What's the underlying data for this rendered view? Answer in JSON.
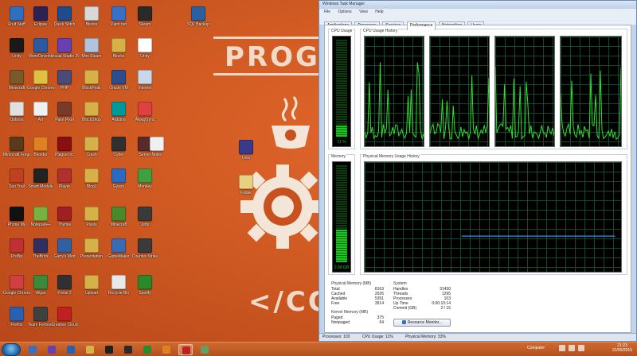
{
  "desktop": {
    "wallpaper_text": {
      "heading": "PROGRA",
      "code": "</CO"
    },
    "icons": [
      {
        "label": "Fruit Stuff",
        "color": "#2e6fbf"
      },
      {
        "label": "Eclipse",
        "color": "#2c2255"
      },
      {
        "label": "Quick Stitch",
        "color": "#1e4b8c"
      },
      {
        "label": "Blocks",
        "color": "#d8d8d8"
      },
      {
        "label": "Paint.net",
        "color": "#3a6fc8"
      },
      {
        "label": "Steam",
        "color": "#2a2a2a"
      },
      {
        "label": "Unity",
        "color": "#1a1a1a"
      },
      {
        "label": "MonoDevelop",
        "color": "#2c5aa0"
      },
      {
        "label": "Visual Studio 2013",
        "color": "#6a3fb0"
      },
      {
        "label": "Mini Steam",
        "color": "#b0c4de"
      },
      {
        "label": "Blocks",
        "color": "#d8b048"
      },
      {
        "label": "Unity",
        "color": "#ffffff"
      },
      {
        "label": "Minecraft",
        "color": "#7a5a2a"
      },
      {
        "label": "Google Chrome",
        "color": "#e0c040"
      },
      {
        "label": "PHP",
        "color": "#4b4b7a"
      },
      {
        "label": "BlockPeak",
        "color": "#d8b048"
      },
      {
        "label": "Oracle VM",
        "color": "#2c4c8c"
      },
      {
        "label": "Internet",
        "color": "#c8d8e8"
      },
      {
        "label": "Options",
        "color": "#e0e0e0"
      },
      {
        "label": "Art",
        "color": "#f0f0f0"
      },
      {
        "label": "Paint Pixel",
        "color": "#7a3a2a"
      },
      {
        "label": "BlockShop",
        "color": "#d8b048"
      },
      {
        "label": "Arduino",
        "color": "#009999"
      },
      {
        "label": "AlwaySync",
        "color": "#e04040"
      },
      {
        "label": "Minecraft Forge",
        "color": "#5a3a1a"
      },
      {
        "label": "Blender",
        "color": "#e08020"
      },
      {
        "label": "Plague Inc",
        "color": "#8a1010"
      },
      {
        "label": "Crash",
        "color": "#d8b048"
      },
      {
        "label": "Cyber",
        "color": "#303030"
      },
      {
        "label": "Server",
        "color": "#5a2a2a"
      },
      {
        "label": "Sun Trail",
        "color": "#c04020"
      },
      {
        "label": "Smart Module",
        "color": "#222222"
      },
      {
        "label": "Player",
        "color": "#b03030"
      },
      {
        "label": "BlogJ",
        "color": "#d8b048"
      },
      {
        "label": "Gyazo",
        "color": "#2a6ac0"
      },
      {
        "label": "Monkey",
        "color": "#40a040"
      },
      {
        "label": "Phone My",
        "color": "#111111"
      },
      {
        "label": "Notepad++",
        "color": "#7ab040"
      },
      {
        "label": "Thymie",
        "color": "#a02020"
      },
      {
        "label": "Pixels",
        "color": "#d8b048"
      },
      {
        "label": "Minecraft",
        "color": "#4a8a2a"
      },
      {
        "label": "Jetty",
        "color": "#3a3a3a"
      },
      {
        "label": "ProBg",
        "color": "#c03030"
      },
      {
        "label": "TheBrick",
        "color": "#303060"
      },
      {
        "label": "Garry's Mod",
        "color": "#3060a0"
      },
      {
        "label": "Presentation",
        "color": "#d8b048"
      },
      {
        "label": "GameMaker",
        "color": "#3a6ab0"
      },
      {
        "label": "Counter-Strike",
        "color": "#3a3a3a"
      },
      {
        "label": "Google Chrome",
        "color": "#d04040"
      },
      {
        "label": "Wigar",
        "color": "#3a8a3a"
      },
      {
        "label": "Portal 2",
        "color": "#303030"
      },
      {
        "label": "Upload",
        "color": "#d8b048"
      },
      {
        "label": "Recycle Bin",
        "color": "#e8e8e8"
      },
      {
        "label": "Spotify",
        "color": "#2a8a2a"
      },
      {
        "label": "Firefox",
        "color": "#2a60b0"
      },
      {
        "label": "Team Fortress",
        "color": "#404040"
      },
      {
        "label": "Creative Cloud",
        "color": "#c02020"
      },
      {
        "label": "SQL Backup",
        "color": "#2a60a0"
      },
      {
        "label": "Unix",
        "color": "#3a3a8a"
      },
      {
        "label": "Folder",
        "color": "#e8d080"
      },
      {
        "label": "Notes",
        "color": "#f0f0f0"
      }
    ]
  },
  "taskmgr": {
    "title": "Windows Task Manager",
    "menu": [
      "File",
      "Options",
      "View",
      "Help"
    ],
    "tabs": [
      "Applications",
      "Processes",
      "Services",
      "Performance",
      "Networking",
      "Users"
    ],
    "active_tab": "Performance",
    "cpu_usage": {
      "label": "CPU Usage",
      "value_text": "11 %",
      "percent": 11
    },
    "cpu_history": {
      "label": "CPU Usage History",
      "cores": 4
    },
    "memory": {
      "label": "Memory",
      "value_text": "2.68 GB",
      "percent": 33
    },
    "memory_history": {
      "label": "Physical Memory Usage History",
      "level": 33
    },
    "physical_memory": {
      "title": "Physical Memory (MB)",
      "rows": [
        {
          "k": "Total",
          "v": "8163"
        },
        {
          "k": "Cached",
          "v": "2026"
        },
        {
          "k": "Available",
          "v": "5391"
        },
        {
          "k": "Free",
          "v": "3514"
        }
      ]
    },
    "kernel_memory": {
      "title": "Kernel Memory (MB)",
      "rows": [
        {
          "k": "Paged",
          "v": "375"
        },
        {
          "k": "Nonpaged",
          "v": "64"
        }
      ]
    },
    "system": {
      "title": "System",
      "rows": [
        {
          "k": "Handles",
          "v": "31430"
        },
        {
          "k": "Threads",
          "v": "1295"
        },
        {
          "k": "Processes",
          "v": "103"
        },
        {
          "k": "Up Time",
          "v": "0:00:10:14"
        },
        {
          "k": "Commit (GB)",
          "v": "2 / 15"
        }
      ]
    },
    "resource_monitor_button": "Resource Monitor...",
    "status": {
      "processes": "Processes: 103",
      "cpu": "CPU Usage: 11%",
      "memory": "Physical Memory: 33%"
    }
  },
  "taskbar": {
    "tray_label": "Computer",
    "time": "21:23",
    "date": "31/05/2015",
    "pinned_colors": [
      "#3b6fc2",
      "#6a3fb0",
      "#2a60b0",
      "#d8b048",
      "#202020",
      "#2a2a2a",
      "#2a8a2a",
      "#e08020",
      "#c02020",
      "#60a060"
    ]
  }
}
